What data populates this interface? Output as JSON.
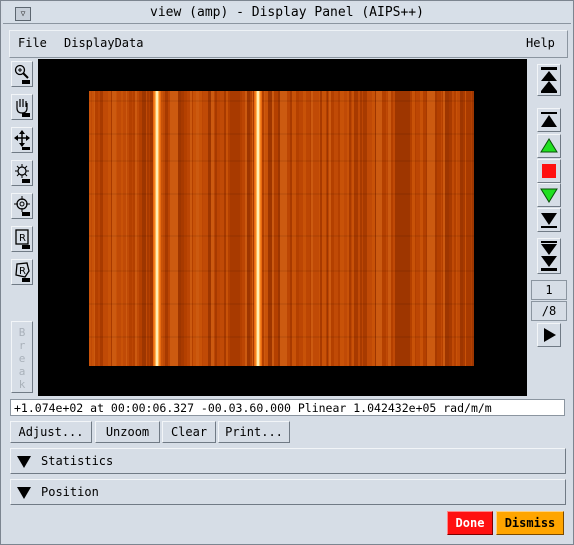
{
  "window": {
    "title": "view (amp) - Display Panel (AIPS++)"
  },
  "menubar": {
    "file": "File",
    "display_data": "DisplayData",
    "help": "Help"
  },
  "tools": {
    "items": [
      "zoom-icon",
      "pan-hand-icon",
      "move-arrows-icon",
      "colormap-icon",
      "crosshair-icon",
      "rectangle-region-icon",
      "polygon-region-icon"
    ],
    "break_label": "Break"
  },
  "animator": {
    "buttons": [
      "rewind-to-start-icon",
      "step-back-icon",
      "play-backward-icon",
      "stop-icon",
      "play-forward-icon",
      "step-forward-icon",
      "skip-to-end-icon"
    ],
    "frame": "1",
    "total": "/8",
    "play_button": "play-icon"
  },
  "status": {
    "text": "+1.074e+02  at 00:00:06.327 -00.03.60.000 Plinear 1.042432e+05 rad/m/m"
  },
  "buttons": {
    "adjust": "Adjust...",
    "unzoom": "Unzoom",
    "clear": "Clear",
    "print": "Print..."
  },
  "sections": {
    "statistics": "Statistics",
    "position": "Position"
  },
  "footer": {
    "done": "Done",
    "dismiss": "Dismiss"
  },
  "colors": {
    "raster_base": "#b84200",
    "bright_line": "#fff4c0",
    "done": "#ff1010",
    "dismiss": "#ffa500"
  }
}
